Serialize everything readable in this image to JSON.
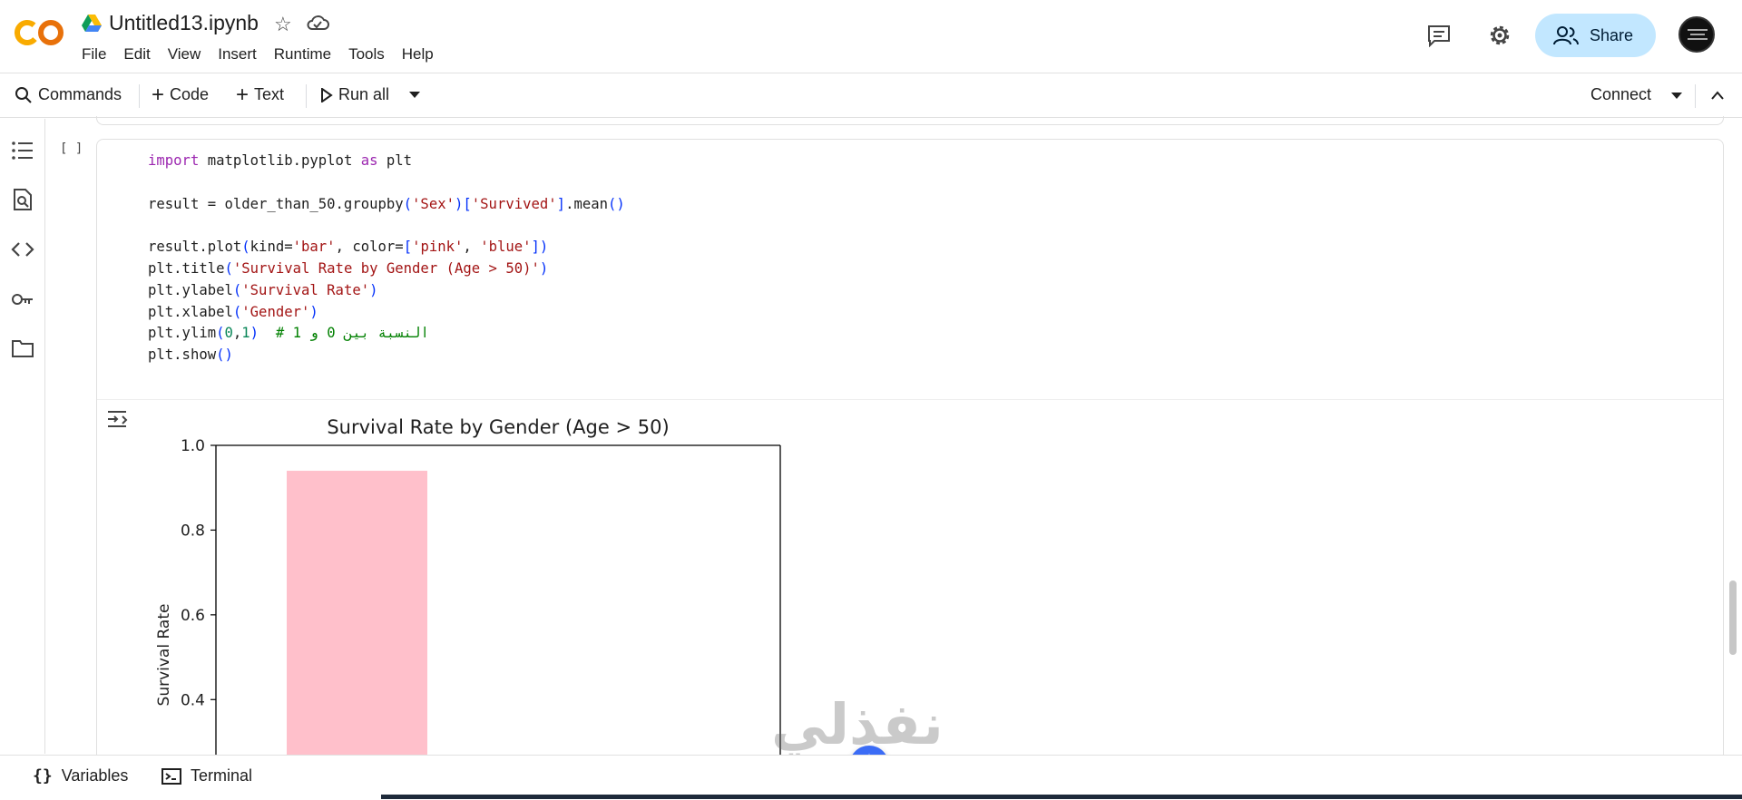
{
  "header": {
    "notebook_title": "Untitled13.ipynb",
    "menu": [
      "File",
      "Edit",
      "View",
      "Insert",
      "Runtime",
      "Tools",
      "Help"
    ],
    "share_label": "Share"
  },
  "toolbar": {
    "commands_label": "Commands",
    "code_label": "Code",
    "text_label": "Text",
    "run_all_label": "Run all",
    "connect_label": "Connect"
  },
  "cell": {
    "run_indicator": "[ ]",
    "code_lines": [
      "import matplotlib.pyplot as plt",
      "",
      "result = older_than_50.groupby('Sex')['Survived'].mean()",
      "",
      "result.plot(kind='bar', color=['pink', 'blue'])",
      "plt.title('Survival Rate by Gender (Age > 50)')",
      "plt.ylabel('Survival Rate')",
      "plt.xlabel('Gender')",
      "plt.ylim(0,1)  # النسبة بين 0 و 1",
      "plt.show()"
    ]
  },
  "chart_data": {
    "type": "bar",
    "title": "Survival Rate by Gender (Age > 50)",
    "ylabel": "Survival Rate",
    "xlabel": "",
    "ylim": [
      0,
      1
    ],
    "visible_y_range": [
      0.27,
      1.0
    ],
    "yticks": [
      "1.0",
      "0.8",
      "0.6",
      "0.4"
    ],
    "ytick_values": [
      1.0,
      0.8,
      0.6,
      0.4
    ],
    "bars": [
      {
        "value": 0.94,
        "color": "#ffc0cb"
      }
    ]
  },
  "bottombar": {
    "variables_label": "Variables",
    "terminal_label": "Terminal"
  },
  "watermark": {
    "arabic": "نفذلي",
    "latin": "nafezly.com"
  }
}
